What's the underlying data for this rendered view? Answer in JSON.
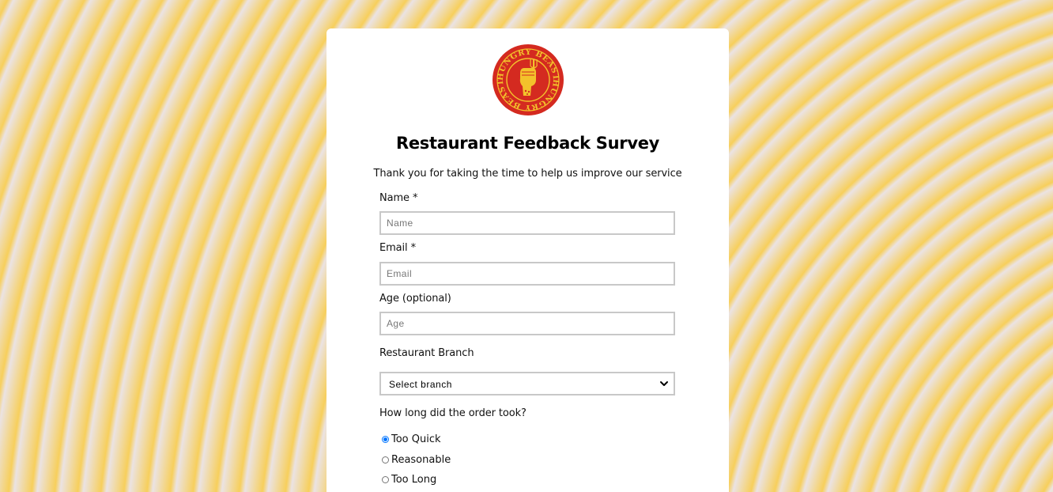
{
  "brand": {
    "logo_text": "HUNGRY BEAST",
    "logo_icon": "raised-fist-fork-icon",
    "colors": {
      "logo_red": "#d42a20",
      "logo_gold": "#f3c22b"
    }
  },
  "form": {
    "title": "Restaurant Feedback Survey",
    "subtitle": "Thank you for taking the time to help us improve our service",
    "name": {
      "label": "Name *",
      "placeholder": "Name",
      "value": ""
    },
    "email": {
      "label": "Email *",
      "placeholder": "Email",
      "value": ""
    },
    "age": {
      "label": "Age (optional)",
      "placeholder": "Age",
      "value": ""
    },
    "branch": {
      "label": "Restaurant Branch",
      "selected": "Select branch",
      "icon": "chevron-down-icon"
    },
    "order_time": {
      "question": "How long did the order took?",
      "options": [
        {
          "label": "Too Quick",
          "checked": true
        },
        {
          "label": "Reasonable",
          "checked": false
        },
        {
          "label": "Too Long",
          "checked": false
        }
      ]
    }
  },
  "theme": {
    "background_stripe_gold": "#f7cf5c",
    "background_stripe_light": "#ebe3e3",
    "radio_accent": "#0075ff"
  }
}
